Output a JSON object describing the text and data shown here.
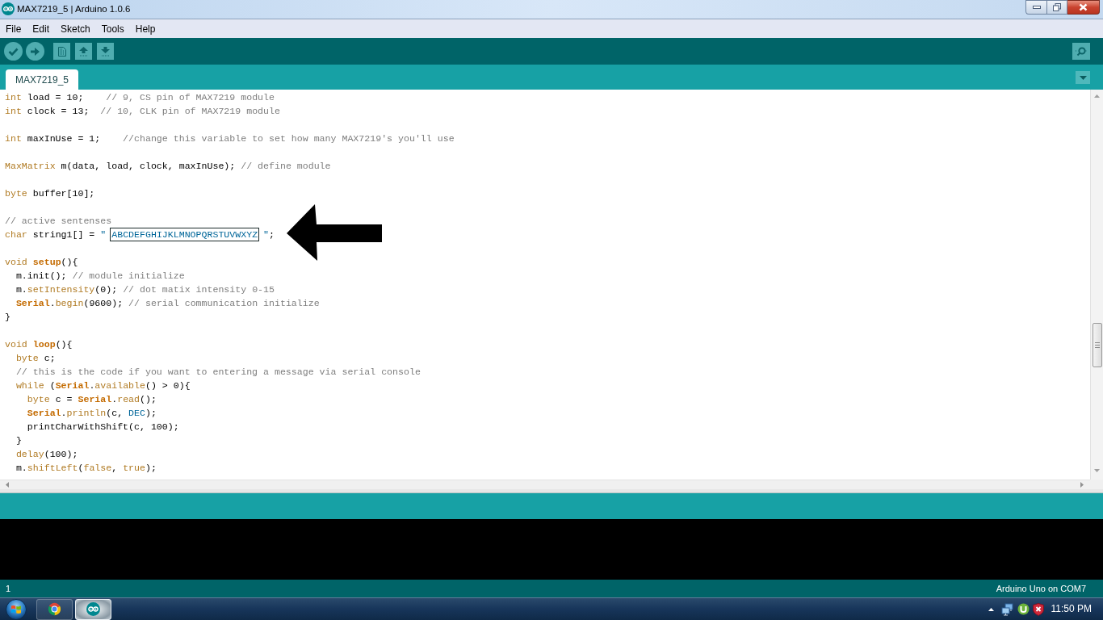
{
  "window": {
    "title": "MAX7219_5 | Arduino 1.0.6"
  },
  "menu": [
    "File",
    "Edit",
    "Sketch",
    "Tools",
    "Help"
  ],
  "tabs": [
    {
      "label": "MAX7219_5",
      "selected": true
    }
  ],
  "editor": {
    "lines": [
      {
        "kind": "code",
        "tokens": [
          {
            "text": "int",
            "kind": "keyword"
          },
          {
            "text": " load = 10;    ",
            "kind": "plain"
          },
          {
            "text": "// 9, CS pin of MAX7219 module",
            "kind": "comment"
          }
        ]
      },
      {
        "kind": "code",
        "tokens": [
          {
            "text": "int",
            "kind": "keyword"
          },
          {
            "text": " clock = 13;  ",
            "kind": "plain"
          },
          {
            "text": "// 10, CLK pin of MAX7219 module",
            "kind": "comment"
          }
        ]
      },
      {
        "kind": "blank"
      },
      {
        "kind": "code",
        "tokens": [
          {
            "text": "int",
            "kind": "keyword"
          },
          {
            "text": " maxInUse = 1;    ",
            "kind": "plain"
          },
          {
            "text": "//change this variable to set how many MAX7219's you'll use",
            "kind": "comment"
          }
        ]
      },
      {
        "kind": "blank"
      },
      {
        "kind": "code",
        "tokens": [
          {
            "text": "MaxMatrix",
            "kind": "keyword"
          },
          {
            "text": " m(data, load, clock, maxInUse); ",
            "kind": "plain"
          },
          {
            "text": "// define module",
            "kind": "comment"
          }
        ]
      },
      {
        "kind": "blank"
      },
      {
        "kind": "code",
        "tokens": [
          {
            "text": "byte",
            "kind": "keyword"
          },
          {
            "text": " buffer[10];",
            "kind": "plain"
          }
        ]
      },
      {
        "kind": "blank"
      },
      {
        "kind": "code",
        "tokens": [
          {
            "text": "// active sentenses",
            "kind": "comment"
          }
        ]
      },
      {
        "kind": "code",
        "tokens": [
          {
            "text": "char",
            "kind": "keyword"
          },
          {
            "text": " string1[] = ",
            "kind": "plain"
          },
          {
            "text": "\" ",
            "kind": "string"
          },
          {
            "text": "ABCDEFGHIJKLMNOPQRSTUVWXYZ",
            "kind": "boxed_string"
          },
          {
            "text": " \"",
            "kind": "string"
          },
          {
            "text": ";",
            "kind": "plain"
          }
        ]
      },
      {
        "kind": "blank"
      },
      {
        "kind": "code",
        "tokens": [
          {
            "text": "void ",
            "kind": "keyword"
          },
          {
            "text": "setup",
            "kind": "bold"
          },
          {
            "text": "(){",
            "kind": "plain"
          }
        ]
      },
      {
        "kind": "code",
        "tokens": [
          {
            "text": "  m.init(); ",
            "kind": "plain"
          },
          {
            "text": "// module initialize",
            "kind": "comment"
          }
        ]
      },
      {
        "kind": "code",
        "tokens": [
          {
            "text": "  m.",
            "kind": "plain"
          },
          {
            "text": "setIntensity",
            "kind": "function"
          },
          {
            "text": "(0); ",
            "kind": "plain"
          },
          {
            "text": "// dot matix intensity 0-15",
            "kind": "comment"
          }
        ]
      },
      {
        "kind": "code",
        "tokens": [
          {
            "text": "  Serial",
            "kind": "bold"
          },
          {
            "text": ".",
            "kind": "plain"
          },
          {
            "text": "begin",
            "kind": "function"
          },
          {
            "text": "(9600); ",
            "kind": "plain"
          },
          {
            "text": "// serial communication initialize",
            "kind": "comment"
          }
        ]
      },
      {
        "kind": "code",
        "tokens": [
          {
            "text": "}",
            "kind": "plain"
          }
        ]
      },
      {
        "kind": "blank"
      },
      {
        "kind": "code",
        "tokens": [
          {
            "text": "void ",
            "kind": "keyword"
          },
          {
            "text": "loop",
            "kind": "bold"
          },
          {
            "text": "(){",
            "kind": "plain"
          }
        ]
      },
      {
        "kind": "code",
        "tokens": [
          {
            "text": "  byte",
            "kind": "keyword"
          },
          {
            "text": " c;",
            "kind": "plain"
          }
        ]
      },
      {
        "kind": "code",
        "tokens": [
          {
            "text": "  // this is the code if you want to entering a message via serial console",
            "kind": "comment"
          }
        ]
      },
      {
        "kind": "code",
        "tokens": [
          {
            "text": "  while",
            "kind": "keyword"
          },
          {
            "text": " (",
            "kind": "plain"
          },
          {
            "text": "Serial",
            "kind": "bold"
          },
          {
            "text": ".",
            "kind": "plain"
          },
          {
            "text": "available",
            "kind": "function"
          },
          {
            "text": "() > 0){",
            "kind": "plain"
          }
        ]
      },
      {
        "kind": "code",
        "tokens": [
          {
            "text": "    byte",
            "kind": "keyword"
          },
          {
            "text": " c = ",
            "kind": "plain"
          },
          {
            "text": "Serial",
            "kind": "bold"
          },
          {
            "text": ".",
            "kind": "plain"
          },
          {
            "text": "read",
            "kind": "function"
          },
          {
            "text": "();",
            "kind": "plain"
          }
        ]
      },
      {
        "kind": "code",
        "tokens": [
          {
            "text": "    Serial",
            "kind": "bold"
          },
          {
            "text": ".",
            "kind": "plain"
          },
          {
            "text": "println",
            "kind": "function"
          },
          {
            "text": "(c, ",
            "kind": "plain"
          },
          {
            "text": "DEC",
            "kind": "constant"
          },
          {
            "text": ");",
            "kind": "plain"
          }
        ]
      },
      {
        "kind": "code",
        "tokens": [
          {
            "text": "    printCharWithShift(c, 100);",
            "kind": "plain"
          }
        ]
      },
      {
        "kind": "code",
        "tokens": [
          {
            "text": "  }",
            "kind": "plain"
          }
        ]
      },
      {
        "kind": "code",
        "tokens": [
          {
            "text": "  delay",
            "kind": "function"
          },
          {
            "text": "(100);",
            "kind": "plain"
          }
        ]
      },
      {
        "kind": "code",
        "tokens": [
          {
            "text": "  m.",
            "kind": "plain"
          },
          {
            "text": "shiftLeft",
            "kind": "function"
          },
          {
            "text": "(",
            "kind": "plain"
          },
          {
            "text": "false",
            "kind": "keyword"
          },
          {
            "text": ", ",
            "kind": "plain"
          },
          {
            "text": "true",
            "kind": "keyword"
          },
          {
            "text": ");",
            "kind": "plain"
          }
        ]
      }
    ]
  },
  "status_bar": {
    "line": "1",
    "board": "Arduino Uno on COM7"
  },
  "taskbar": {
    "apps": [
      {
        "kind": "browser",
        "selected": false
      },
      {
        "kind": "arduino",
        "selected": true
      }
    ],
    "clock": "11:50 PM"
  }
}
